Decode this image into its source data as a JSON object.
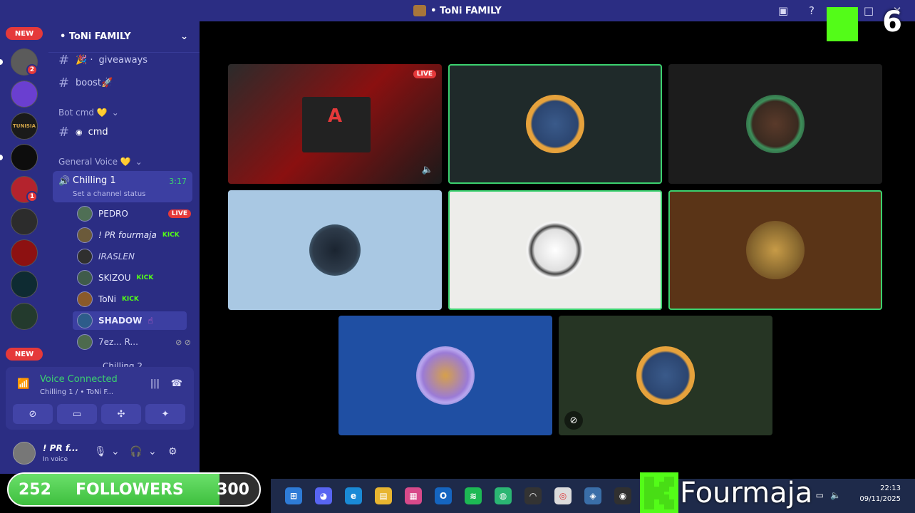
{
  "window": {
    "title": "• ToNi FAMILY"
  },
  "kick_overlay": {
    "viewer_count": "6",
    "channel_name": "Fourmaja"
  },
  "rail": {
    "new_top": "NEW",
    "new_bottom": "NEW",
    "badge_a": "2",
    "badge_b": "1",
    "server_label": "TUNISIA"
  },
  "sidebar": {
    "server_name": "• ToNi FAMILY",
    "channels": [
      {
        "name": "giveaways",
        "prefix": "🎉 ·"
      },
      {
        "name": "boost🚀"
      }
    ],
    "category_bot": "Bot cmd 💛",
    "bot_channel": "cmd",
    "category_voice": "General Voice 💛",
    "voice_channel": {
      "name": "Chilling 1",
      "time": "3:17",
      "status": "Set a channel status"
    },
    "members": [
      {
        "name": "PEDRO",
        "extra": "LIVE"
      },
      {
        "name": "! PR fourmaja",
        "extra": "KICK"
      },
      {
        "name": "IRASLEN",
        "extra": ""
      },
      {
        "name": "SKIZOU",
        "extra": "KICK"
      },
      {
        "name": "ToNi",
        "extra": "KICK"
      },
      {
        "name": "SHADOW",
        "extra": ""
      },
      {
        "name": "7ez... R...",
        "extra": ""
      }
    ],
    "next_channel": "Chilling 2"
  },
  "voice_panel": {
    "title": "Voice Connected",
    "sub": "Chilling 1 / • ToNi F..."
  },
  "user_panel": {
    "name": "! PR f...",
    "status": "In voice"
  },
  "stream_tile": {
    "live_label": "LIVE"
  },
  "tiles": [
    {
      "kind": "stream"
    },
    {
      "kind": "avatar",
      "bg": "#1f2a2a",
      "speaking": true,
      "ring": "#e6a23c"
    },
    {
      "kind": "avatar",
      "bg": "#1c1c1c",
      "speaking": false,
      "ring": "#3d8f5a"
    },
    {
      "kind": "avatar",
      "bg": "#a9c8e3",
      "speaking": false,
      "ring": "#2e3b4a"
    },
    {
      "kind": "avatar",
      "bg": "#ededea",
      "speaking": true,
      "ring": "#f2f2f2"
    },
    {
      "kind": "avatar",
      "bg": "#5a3417",
      "speaking": true,
      "ring": "#c79b47"
    },
    {
      "kind": "avatar",
      "bg": "#1f4fa3",
      "speaking": false,
      "ring": "#9b7bd6"
    },
    {
      "kind": "avatar",
      "bg": "#263524",
      "speaking": false,
      "ring": "#e6a23c"
    }
  ],
  "followers": {
    "current": "252",
    "label": "FOLLOWERS",
    "goal": "300",
    "progress": 0.84
  },
  "taskbar": {
    "time": "22:13",
    "date": "09/11/2025"
  },
  "colors": {
    "discord_bg": "#2b2d83",
    "kick_green": "#53fc18",
    "live_red": "#e5393a",
    "speaking_green": "#3bd16f"
  }
}
